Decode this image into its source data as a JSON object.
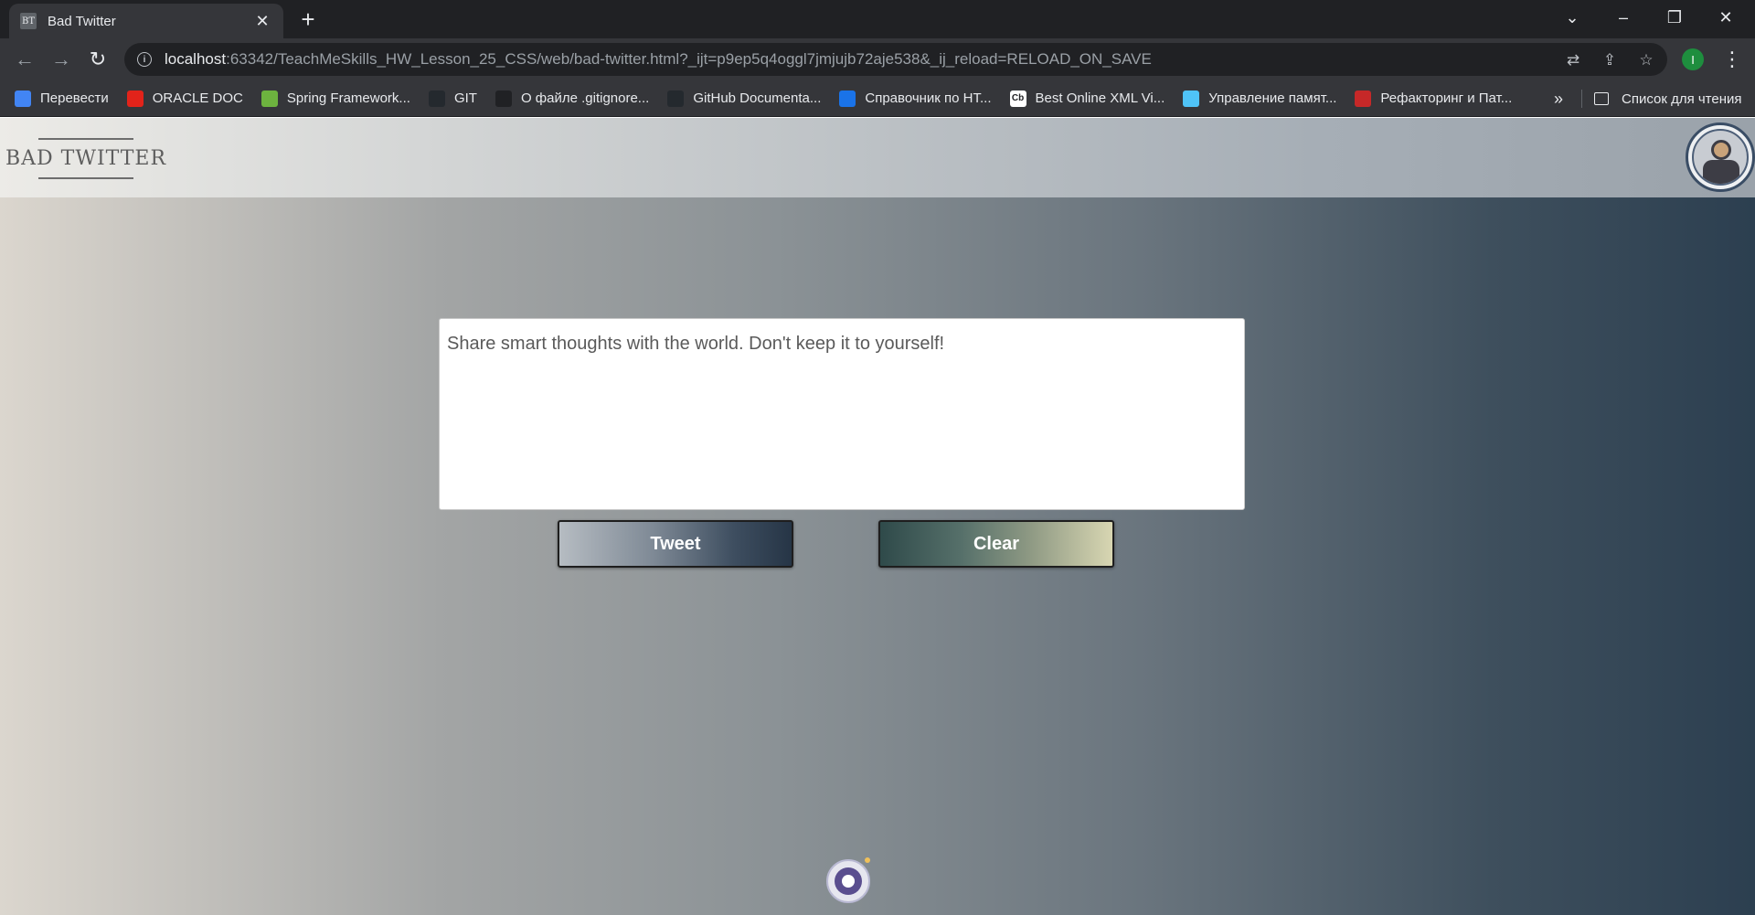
{
  "browser": {
    "tab_title": "Bad Twitter",
    "favicon_text": "BT",
    "url_host": "localhost",
    "url_rest": ":63342/TeachMeSkills_HW_Lesson_25_CSS/web/bad-twitter.html?_ijt=p9ep5q4oggl7jmjujb72aje538&_ij_reload=RELOAD_ON_SAVE",
    "profile_initial": "I",
    "bookmarks": [
      {
        "label": "Перевести",
        "icon": "translate-icon",
        "color": "#4285f4"
      },
      {
        "label": "ORACLE DOC",
        "icon": "oracle-icon",
        "color": "#e2231a"
      },
      {
        "label": "Spring Framework...",
        "icon": "spring-icon",
        "color": "#6db33f"
      },
      {
        "label": "GIT",
        "icon": "github-icon",
        "color": "#24292e"
      },
      {
        "label": "О файле .gitignore...",
        "icon": "tk-icon",
        "color": "#202124"
      },
      {
        "label": "GitHub Documenta...",
        "icon": "github-icon",
        "color": "#24292e"
      },
      {
        "label": "Справочник по HT...",
        "icon": "html-icon",
        "color": "#1a73e8"
      },
      {
        "label": "Best Online XML Vi...",
        "icon": "cb-icon",
        "color": "#ffffff"
      },
      {
        "label": "Управление памят...",
        "icon": "memory-icon",
        "color": "#4fc3f7"
      },
      {
        "label": "Рефакторинг и Пат...",
        "icon": "refactoring-icon",
        "color": "#c62828"
      }
    ],
    "bookmarks_more": "»",
    "reading_list": "Список для чтения"
  },
  "site": {
    "logo": "BAD TWITTER",
    "tweet_placeholder": "Share smart thoughts with the world. Don't keep it to yourself!",
    "tweet_button": "Tweet",
    "clear_button": "Clear"
  }
}
